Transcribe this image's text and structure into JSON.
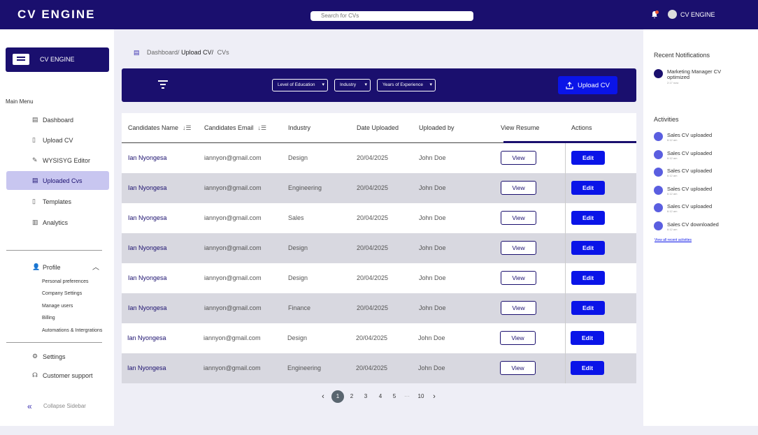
{
  "app": {
    "title": "CV ENGINE",
    "user_name": "CV ENGINE"
  },
  "search": {
    "placeholder": "Search for CVs"
  },
  "sidebar": {
    "brand": "CV ENGINE",
    "main_menu": "Main Menu",
    "items": [
      {
        "label": "Dashboard",
        "icon": "dashboard-icon"
      },
      {
        "label": "Upload CV",
        "icon": "file-icon"
      },
      {
        "label": "WYSISYG Editor",
        "icon": "pen-icon"
      },
      {
        "label": "Uploaded Cvs",
        "icon": "document-icon"
      },
      {
        "label": "Templates",
        "icon": "template-icon"
      },
      {
        "label": "Analytics",
        "icon": "chart-icon"
      }
    ],
    "profile": "Profile",
    "profile_sub": [
      "Personal preferences",
      "Company Settings",
      "Manage users",
      "Billing",
      "Automations & Intergrations"
    ],
    "settings": "Settings",
    "support": "Customer support",
    "collapse": "Collapse Sidebar"
  },
  "breadcrumb": {
    "part1": "Dashboard/",
    "part2": "Upload CV/",
    "part3": "CVs"
  },
  "filters": {
    "education": "Level of Education",
    "industry": "Industry",
    "experience": "Years of Experience",
    "upload": "Upload CV"
  },
  "table": {
    "headers": [
      "Candidates Name",
      "Candidates Email",
      "Industry",
      "Date Uploaded",
      "Uploaded by",
      "View Resume",
      "Actions"
    ],
    "view_label": "View",
    "edit_label": "Edit",
    "rows": [
      {
        "name": "Ian Nyongesa",
        "email": "iannyon@gmail.com",
        "industry": "Design",
        "date": "20/04/2025",
        "by": "John Doe"
      },
      {
        "name": "Ian Nyongesa",
        "email": "iannyon@gmail.com",
        "industry": "Engineering",
        "date": "20/04/2025",
        "by": "John Doe"
      },
      {
        "name": "Ian Nyongesa",
        "email": "iannyon@gmail.com",
        "industry": "Sales",
        "date": "20/04/2025",
        "by": "John Doe"
      },
      {
        "name": "Ian Nyongesa",
        "email": "iannyon@gmail.com",
        "industry": "Design",
        "date": "20/04/2025",
        "by": "John Doe"
      },
      {
        "name": "Ian Nyongesa",
        "email": "iannyon@gmail.com",
        "industry": "Design",
        "date": "20/04/2025",
        "by": "John Doe"
      },
      {
        "name": "Ian Nyongesa",
        "email": "iannyon@gmail.com",
        "industry": "Finance",
        "date": "20/04/2025",
        "by": "John Doe"
      },
      {
        "name": "Ian Nyongesa",
        "email": "iannyon@gmail.com",
        "industry": "Design",
        "date": "20/04/2025",
        "by": "John Doe"
      },
      {
        "name": "Ian Nyongesa",
        "email": "iannyon@gmail.com",
        "industry": "Engineering",
        "date": "20/04/2025",
        "by": "John Doe"
      }
    ]
  },
  "pagination": {
    "pages": [
      "1",
      "2",
      "3",
      "4",
      "5",
      "10"
    ],
    "ellipsis": "···",
    "current": "1"
  },
  "notifications": {
    "title": "Recent Notifications",
    "items": [
      {
        "text": "Marketing Manager CV optimized",
        "time": "2:17 now"
      }
    ]
  },
  "activities": {
    "title": "Activities",
    "items": [
      {
        "text": "Sales CV uploaded",
        "time": "6:12 am"
      },
      {
        "text": "Sales CV uploaded",
        "time": "6:12 am"
      },
      {
        "text": "Sales CV uploaded",
        "time": "6:12 am"
      },
      {
        "text": "Sales  CV uploaded",
        "time": "6:12 am"
      },
      {
        "text": "Sales CV uploaded",
        "time": "6:12 am"
      },
      {
        "text": "Sales CV downloaded",
        "time": "6:12 am"
      }
    ],
    "view_all": "View all recent activities"
  },
  "colors": {
    "primary": "#1a0f6e",
    "accent": "#0a14e8",
    "active_nav": "#c8c6f0",
    "row_alt": "#d8d8e0"
  }
}
